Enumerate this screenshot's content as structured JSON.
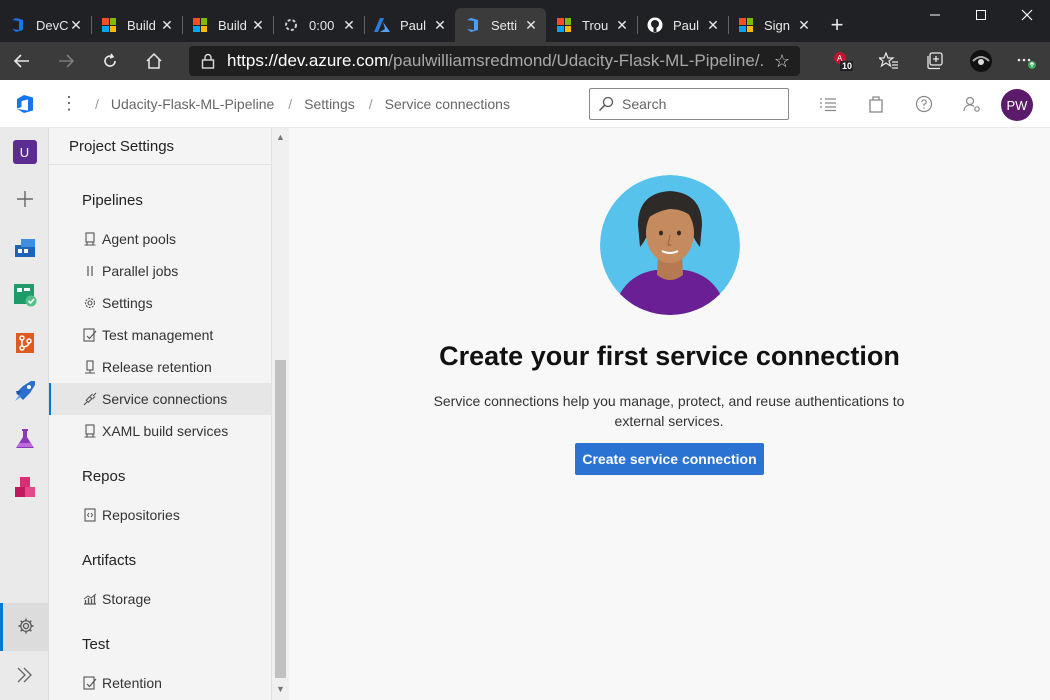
{
  "browser": {
    "tabs": [
      {
        "title": "DevC",
        "icon": "azure-devops-icon",
        "active": false
      },
      {
        "title": "Build",
        "icon": "microsoft-icon",
        "active": false
      },
      {
        "title": "Build",
        "icon": "microsoft-icon",
        "active": false
      },
      {
        "title": "0:00",
        "icon": "loading-icon",
        "active": false
      },
      {
        "title": "Paul",
        "icon": "azure-icon",
        "active": false
      },
      {
        "title": "Setti",
        "icon": "azure-devops-icon",
        "active": true
      },
      {
        "title": "Trou",
        "icon": "microsoft-icon",
        "active": false
      },
      {
        "title": "Paul",
        "icon": "github-icon",
        "active": false
      },
      {
        "title": "Sign",
        "icon": "microsoft-icon",
        "active": false
      }
    ],
    "close_glyph": "✕",
    "new_tab": "+",
    "url_host": "https://dev.azure.com",
    "url_path": "/paulwilliamsredmond/Udacity-Flask-ML-Pipeline/...",
    "extension_badge": "10"
  },
  "header": {
    "breadcrumb": [
      "Udacity-Flask-ML-Pipeline",
      "Settings",
      "Service connections"
    ],
    "search_placeholder": "Search",
    "avatar_initials": "PW"
  },
  "rail": {
    "project_letter": "U"
  },
  "settings_panel": {
    "title": "Project Settings",
    "sections": [
      {
        "name": "Pipelines",
        "items": [
          "Agent pools",
          "Parallel jobs",
          "Settings",
          "Test management",
          "Release retention",
          "Service connections",
          "XAML build services"
        ]
      },
      {
        "name": "Repos",
        "items": [
          "Repositories"
        ]
      },
      {
        "name": "Artifacts",
        "items": [
          "Storage"
        ]
      },
      {
        "name": "Test",
        "items": [
          "Retention"
        ]
      }
    ],
    "selected": "Service connections"
  },
  "main": {
    "heading": "Create your first service connection",
    "description": "Service connections help you manage, protect, and reuse authentications to external services.",
    "button_label": "Create service connection"
  },
  "colors": {
    "accent": "#0078d4",
    "button": "#2b73d2",
    "avatar": "#5c1a6a"
  }
}
